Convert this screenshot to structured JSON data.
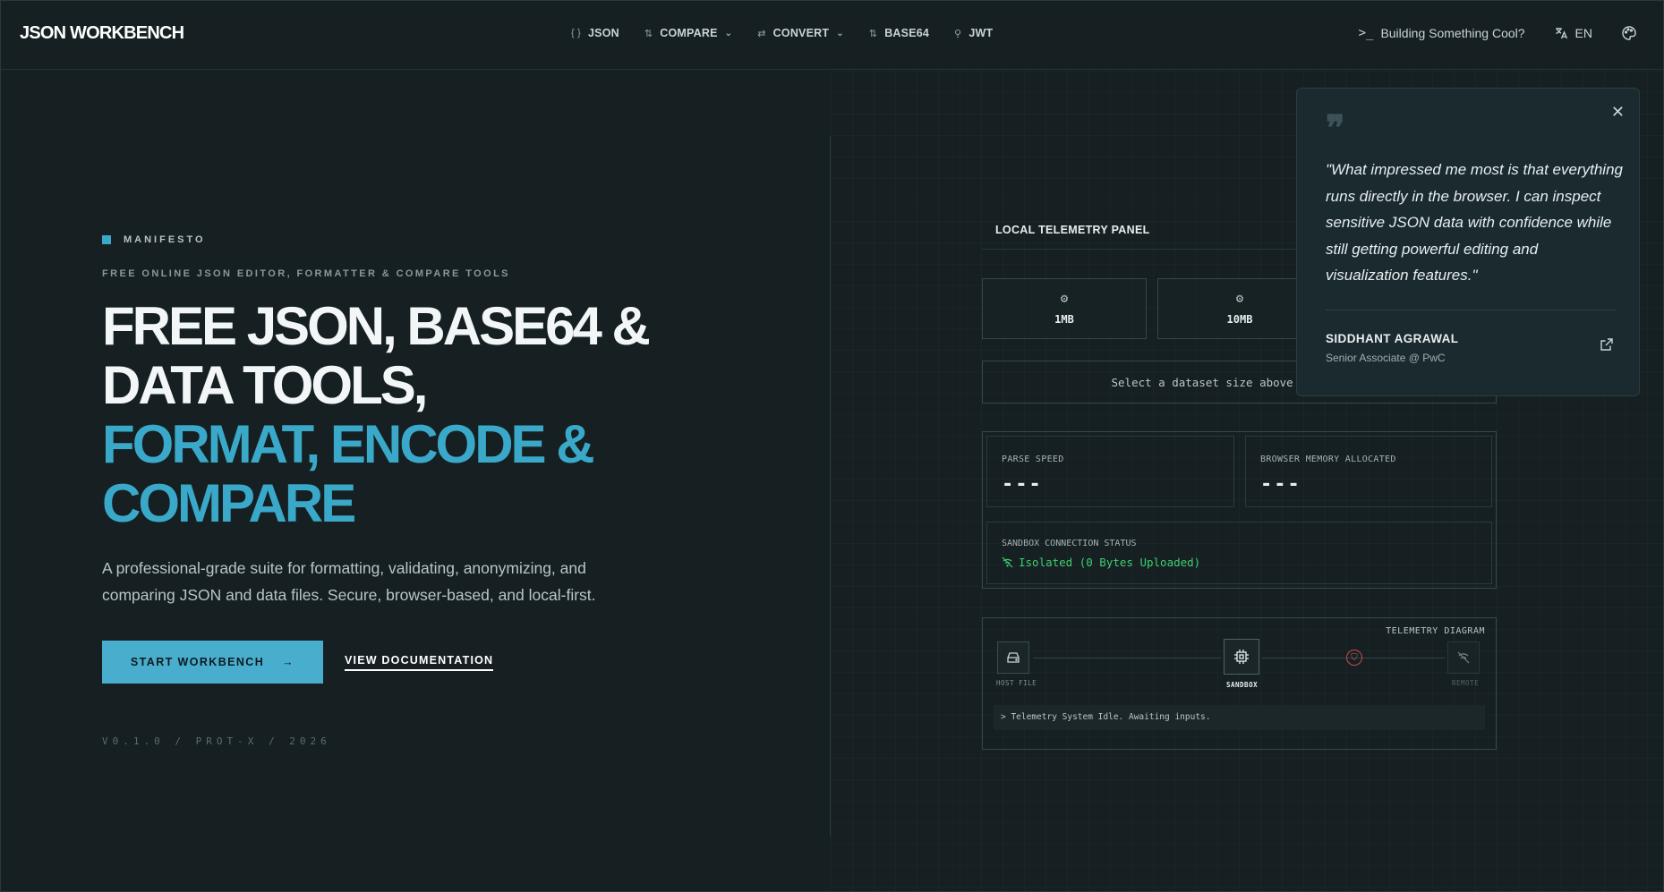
{
  "brand": {
    "logo": "JSON WORKBENCH",
    "accent": "#3aa9c9"
  },
  "nav": {
    "links": [
      {
        "icon": "{ }",
        "label": "JSON",
        "dropdown": false
      },
      {
        "icon": "⇅",
        "label": "COMPARE",
        "dropdown": true
      },
      {
        "icon": "⇄",
        "label": "CONVERT",
        "dropdown": true
      },
      {
        "icon": "⇅",
        "label": "BASE64",
        "dropdown": false
      },
      {
        "icon": "⚲",
        "label": "JWT",
        "dropdown": false
      }
    ],
    "cta": "Building Something Cool?",
    "language": "EN"
  },
  "hero": {
    "eyebrow": "MANIFESTO",
    "subeyebrow": "FREE ONLINE JSON EDITOR, FORMATTER & COMPARE TOOLS",
    "headline_line1": "FREE JSON, BASE64 &",
    "headline_line2": "DATA TOOLS,",
    "headline_accent1": "FORMAT, ENCODE &",
    "headline_accent2": "COMPARE",
    "description": "A professional-grade suite for formatting, validating, anonymizing, and comparing JSON and data files. Secure, browser-based, and local-first.",
    "primary_button": "START WORKBENCH",
    "secondary_button": "VIEW DOCUMENTATION",
    "version": "V0.1.0 / PROT-X / 2026"
  },
  "telemetry": {
    "title": "LOCAL TELEMETRY PANEL",
    "sizes": [
      "1MB",
      "10MB"
    ],
    "select_prompt": "Select a dataset size above to start t",
    "parse_speed_label": "PARSE SPEED",
    "parse_speed_value": "---",
    "memory_label": "BROWSER MEMORY ALLOCATED",
    "memory_value": "---",
    "sandbox_label": "SANDBOX CONNECTION STATUS",
    "sandbox_value": "Isolated (0 Bytes Uploaded)",
    "sandbox_color": "#3fce6e",
    "diagram_title": "TELEMETRY DIAGRAM",
    "node_host": "HOST FILE",
    "node_sandbox": "SANDBOX",
    "node_remote": "REMOTE",
    "console": "> Telemetry System Idle. Awaiting inputs."
  },
  "testimonial": {
    "quote": "\"What impressed me most is that everything runs directly in the browser. I can inspect sensitive JSON data with confidence while still getting powerful editing and visualization features.\"",
    "name": "SIDDHANT AGRAWAL",
    "role": "Senior Associate @ PwC"
  }
}
